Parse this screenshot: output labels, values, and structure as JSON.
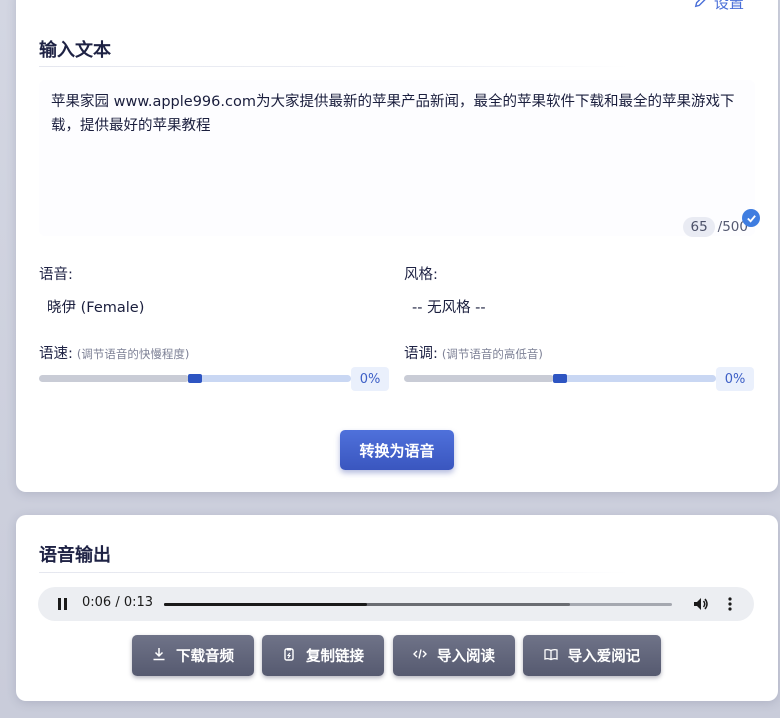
{
  "header": {
    "settings_label": "设置"
  },
  "input_section": {
    "title": "输入文本",
    "text": "苹果家园 www.apple996.com为大家提供最新的苹果产品新闻，最全的苹果软件下载和最全的苹果游戏下载，提供最好的苹果教程",
    "char_count": "65",
    "char_limit": "/500"
  },
  "voice": {
    "label": "语音:",
    "selected": "晓伊 (Female)"
  },
  "style": {
    "label": "风格:",
    "selected": "-- 无风格 --"
  },
  "rate": {
    "label": "语速:",
    "hint": "(调节语音的快慢程度)",
    "value_text": "0%",
    "value": 0
  },
  "pitch": {
    "label": "语调:",
    "hint": "(调节语音的高低音)",
    "value_text": "0%",
    "value": 0
  },
  "convert_button": "转换为语音",
  "output_section": {
    "title": "语音输出",
    "player": {
      "current_time": "0:06",
      "separator": "/",
      "duration": "0:13",
      "played_fraction": 0.4,
      "buffered_fraction": 0.8
    },
    "buttons": {
      "download": "下载音频",
      "copy_link": "复制链接",
      "import_read": "导入阅读",
      "import_aiyueji": "导入爱阅记"
    }
  },
  "colors": {
    "accent": "#3f5fcf",
    "button_gray": "#62667c",
    "check_badge": "#3f7de0"
  },
  "icons": [
    "pencil-icon",
    "check-icon",
    "pause-icon",
    "volume-icon",
    "more-vert-icon",
    "download-icon",
    "copy-icon",
    "code-icon",
    "book-icon"
  ]
}
